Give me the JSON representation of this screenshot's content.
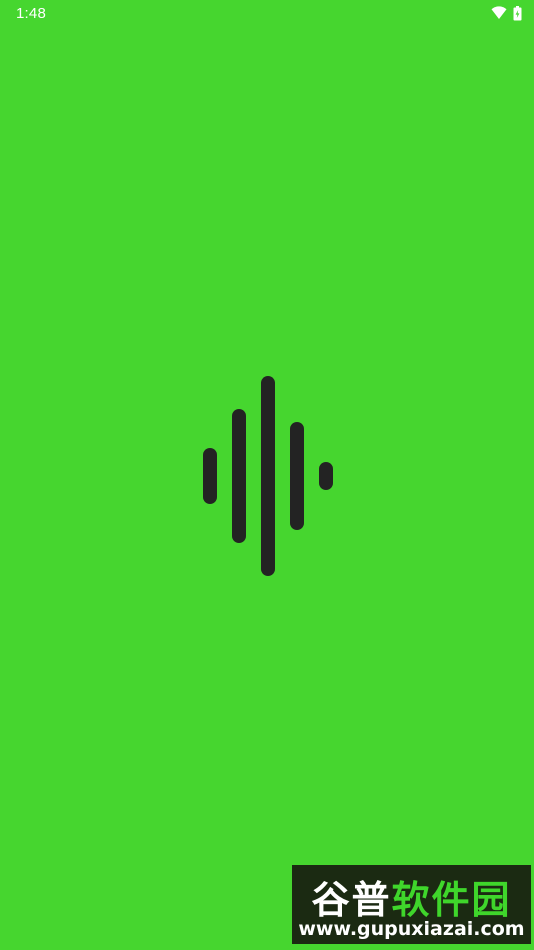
{
  "status_bar": {
    "time": "1:48",
    "icons": [
      "wifi-icon",
      "battery-icon"
    ]
  },
  "splash": {
    "logo_icon": "sound-wave-icon",
    "bar_levels": [
      0.28,
      0.67,
      1.0,
      0.54,
      0.14
    ],
    "bar_color": "#232323"
  },
  "theme": {
    "background": "#46d62f",
    "status_text_color": "#ffffff"
  },
  "watermark": {
    "brand_part1": "谷普",
    "brand_part2": "软件园",
    "url": "www.gupuxiazai.com",
    "background": "#1b2a12",
    "accent": "#3fd62b"
  }
}
